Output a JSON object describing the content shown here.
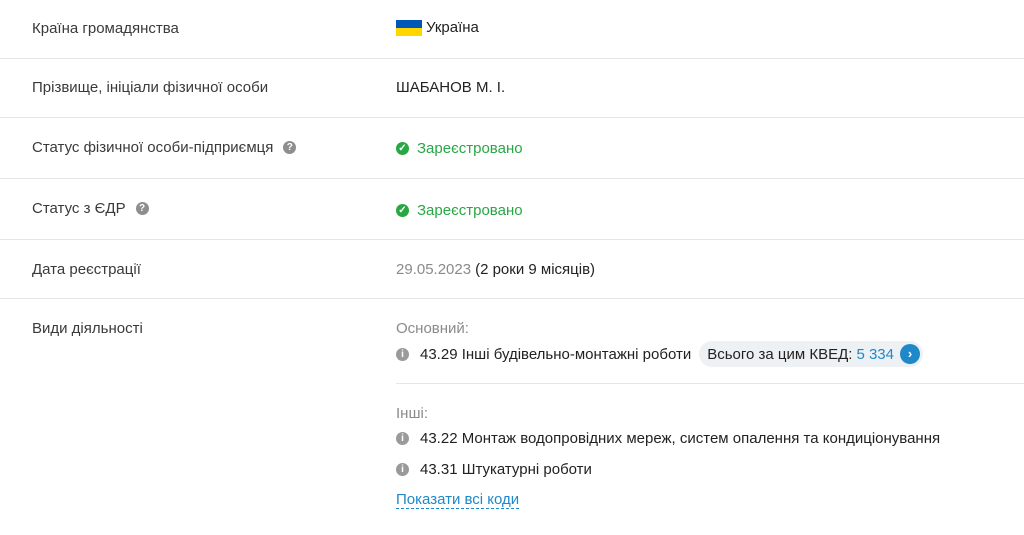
{
  "rows": {
    "citizenship": {
      "label": "Країна громадянства",
      "value": "Україна",
      "flag_colors": [
        "#0057B7",
        "#FFD700"
      ]
    },
    "name": {
      "label": "Прізвище, ініціали фізичної особи",
      "value": "ШАБАНОВ М. І."
    },
    "fop_status": {
      "label": "Статус фізичної особи-підприємця",
      "help_icon": "help-icon",
      "status_icon": "check-circle-icon",
      "value": "Зареєстровано"
    },
    "edr_status": {
      "label": "Статус з ЄДР",
      "help_icon": "help-icon",
      "status_icon": "check-circle-icon",
      "value": "Зареєстровано"
    },
    "reg_date": {
      "label": "Дата реєстрації",
      "date": "29.05.2023",
      "duration": "(2 роки 9 місяців)"
    },
    "activities": {
      "label": "Види діяльності",
      "main_heading": "Основний:",
      "main_item": "43.29 Інші будівельно-монтажні роботи",
      "kved_total_label": "Всього за цим КВЕД:",
      "kved_total_value": "5 334",
      "other_heading": "Інші:",
      "other_items": [
        "43.22 Монтаж водопровідних мереж, систем опалення та кондиціонування",
        "43.31 Штукатурні роботи"
      ],
      "show_all": "Показати всі коди"
    }
  },
  "colors": {
    "success": "#28a745",
    "link": "#1e88c9",
    "muted": "#8a8a8a",
    "border": "#e6e6e6"
  }
}
